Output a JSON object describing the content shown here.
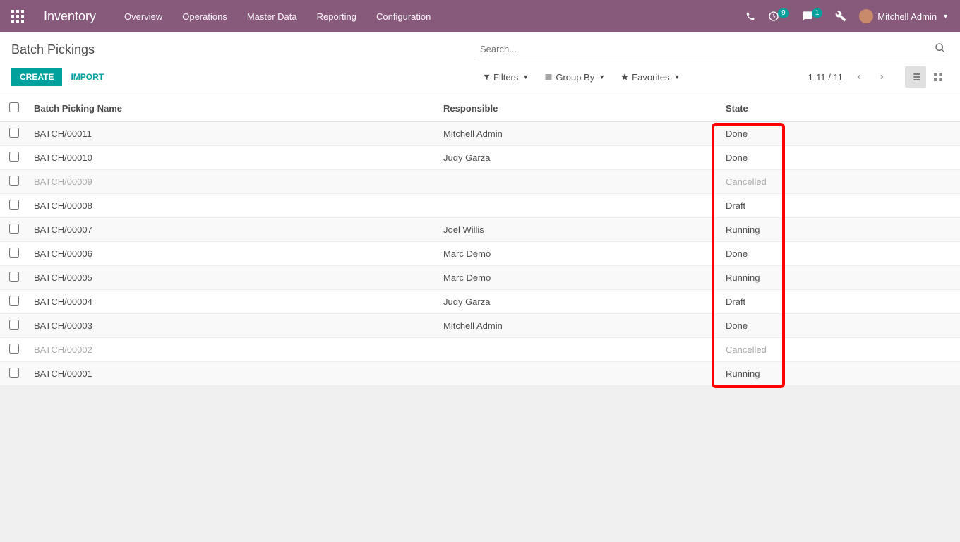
{
  "navbar": {
    "brand": "Inventory",
    "menu": [
      "Overview",
      "Operations",
      "Master Data",
      "Reporting",
      "Configuration"
    ],
    "activities_count": "9",
    "messages_count": "1",
    "user_name": "Mitchell Admin"
  },
  "control_panel": {
    "title": "Batch Pickings",
    "create_label": "CREATE",
    "import_label": "IMPORT",
    "search_placeholder": "Search...",
    "filters_label": "Filters",
    "groupby_label": "Group By",
    "favorites_label": "Favorites",
    "pager": "1-11 / 11"
  },
  "table": {
    "headers": {
      "name": "Batch Picking Name",
      "responsible": "Responsible",
      "state": "State"
    },
    "rows": [
      {
        "name": "BATCH/00011",
        "responsible": "Mitchell Admin",
        "state": "Done",
        "muted": false
      },
      {
        "name": "BATCH/00010",
        "responsible": "Judy Garza",
        "state": "Done",
        "muted": false
      },
      {
        "name": "BATCH/00009",
        "responsible": "",
        "state": "Cancelled",
        "muted": true
      },
      {
        "name": "BATCH/00008",
        "responsible": "",
        "state": "Draft",
        "muted": false
      },
      {
        "name": "BATCH/00007",
        "responsible": "Joel Willis",
        "state": "Running",
        "muted": false
      },
      {
        "name": "BATCH/00006",
        "responsible": "Marc Demo",
        "state": "Done",
        "muted": false
      },
      {
        "name": "BATCH/00005",
        "responsible": "Marc Demo",
        "state": "Running",
        "muted": false
      },
      {
        "name": "BATCH/00004",
        "responsible": "Judy Garza",
        "state": "Draft",
        "muted": false
      },
      {
        "name": "BATCH/00003",
        "responsible": "Mitchell Admin",
        "state": "Done",
        "muted": false
      },
      {
        "name": "BATCH/00002",
        "responsible": "",
        "state": "Cancelled",
        "muted": true
      },
      {
        "name": "BATCH/00001",
        "responsible": "",
        "state": "Running",
        "muted": false
      }
    ]
  }
}
